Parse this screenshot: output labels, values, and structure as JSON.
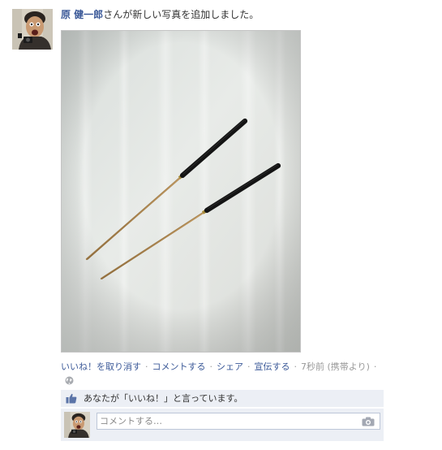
{
  "post": {
    "author": "原 健一郎",
    "headline_rest": "さんが新しい写真を追加しました。"
  },
  "actions": {
    "unlike": "いいね！を取り消す",
    "comment": "コメントする",
    "share": "シェア",
    "promote": "宣伝する",
    "timestamp": "7秒前 (携帯より)",
    "separator": "·"
  },
  "likes": {
    "text": "あなたが「いいね！」と言っています。"
  },
  "comment": {
    "placeholder": "コメントする…"
  },
  "icons": {
    "privacy": "globe-icon",
    "like": "thumbs-up-icon",
    "attach_photo": "camera-icon"
  },
  "colors": {
    "link": "#3b5998",
    "meta": "#999999",
    "panel": "#eceff5"
  }
}
